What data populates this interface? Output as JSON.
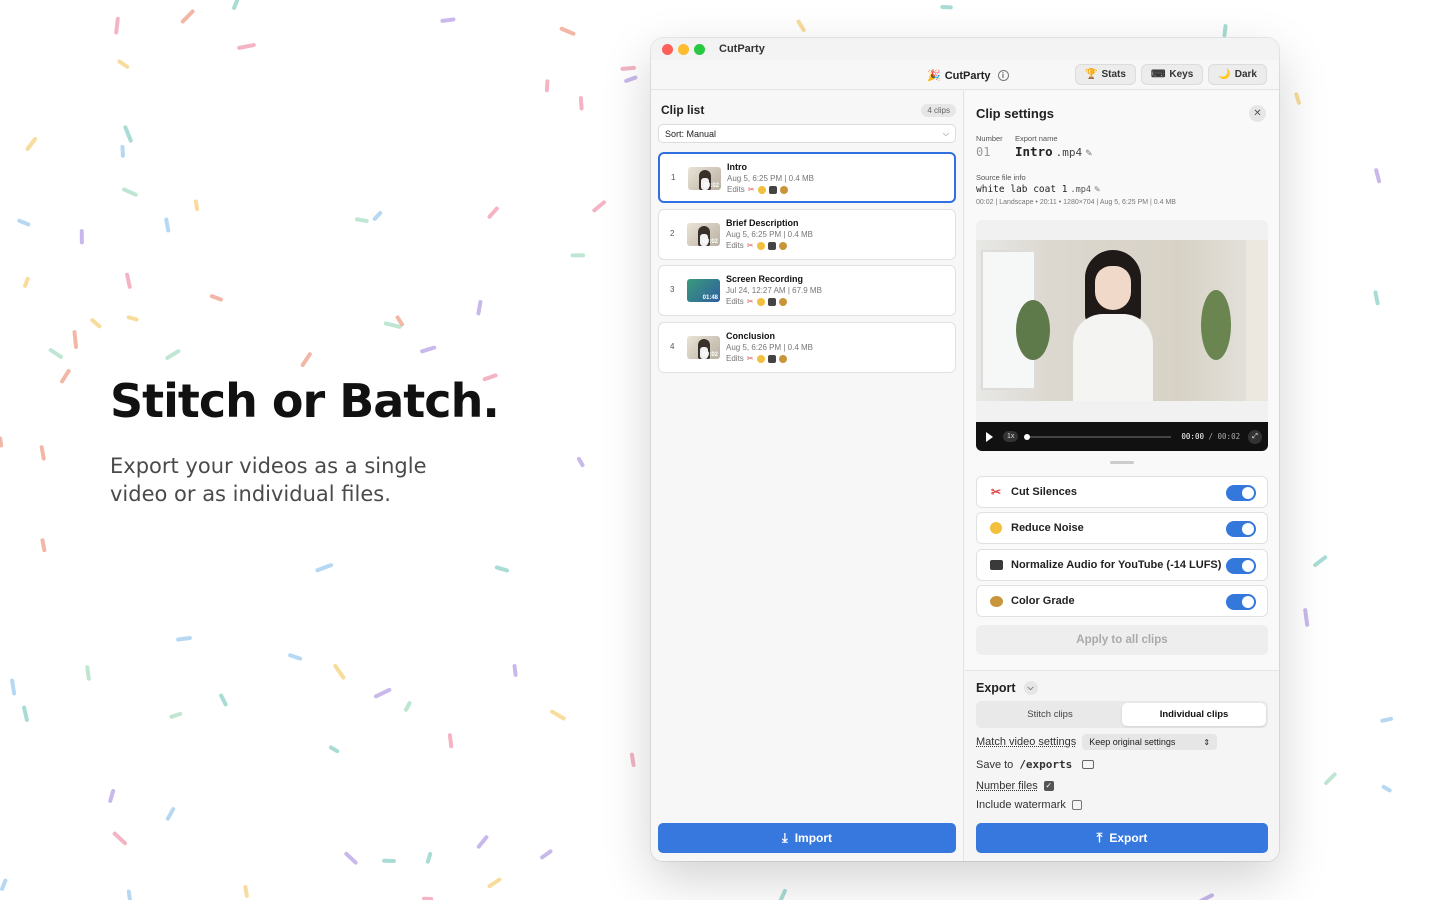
{
  "hero": {
    "headline": "Stitch or Batch.",
    "subtext": "Export your videos as a single video or as individual files."
  },
  "window": {
    "title": "CutParty",
    "app_name": "CutParty",
    "buttons": {
      "stats": "Stats",
      "keys": "Keys",
      "dark": "Dark"
    }
  },
  "clip_list": {
    "title": "Clip list",
    "count": "4 clips",
    "sort": "Sort: Manual",
    "edits_label": "Edits",
    "clips": [
      {
        "num": "1",
        "name": "Intro",
        "meta": "Aug 5, 6:25 PM | 0.4 MB",
        "duration": "00:02"
      },
      {
        "num": "2",
        "name": "Brief Description",
        "meta": "Aug 5, 6:25 PM | 0.4 MB",
        "duration": "00:02"
      },
      {
        "num": "3",
        "name": "Screen Recording",
        "meta": "Jul 24, 12:27 AM | 67.9 MB",
        "duration": "01:48"
      },
      {
        "num": "4",
        "name": "Conclusion",
        "meta": "Aug 5, 6:26 PM | 0.4 MB",
        "duration": "00:02"
      }
    ],
    "import_label": "Import"
  },
  "settings": {
    "title": "Clip settings",
    "number_label": "Number",
    "number_value": "01",
    "export_name_label": "Export name",
    "export_name": "Intro",
    "export_ext": ".mp4",
    "source_label": "Source file info",
    "source_name": "white lab coat 1",
    "source_ext": ".mp4",
    "source_meta": "00:02 | Landscape • 20:11 • 1280×704 | Aug 5, 6:25 PM | 0.4 MB",
    "player": {
      "speed": "1x",
      "current": "00:00",
      "separator": "/",
      "total": "00:02"
    },
    "toggles": [
      {
        "label": "Cut Silences",
        "icon": "scissors-icon",
        "on": true
      },
      {
        "label": "Reduce Noise",
        "icon": "shush-face-icon",
        "on": true
      },
      {
        "label": "Normalize Audio for YouTube (-14 LUFS)",
        "icon": "tv-icon",
        "on": true
      },
      {
        "label": "Color Grade",
        "icon": "palette-icon",
        "on": true
      }
    ],
    "apply_label": "Apply to all clips"
  },
  "export": {
    "title": "Export",
    "modes": [
      "Stitch clips",
      "Individual clips"
    ],
    "selected_mode": "Individual clips",
    "match_label": "Match video settings",
    "match_value": "Keep original settings",
    "save_label": "Save to",
    "save_path": "/exports",
    "number_files_label": "Number files",
    "number_files_checked": true,
    "watermark_label": "Include watermark",
    "watermark_checked": false,
    "export_button": "Export"
  },
  "colors": {
    "accent": "#3678dd",
    "selected_border": "#2f6fe0"
  }
}
